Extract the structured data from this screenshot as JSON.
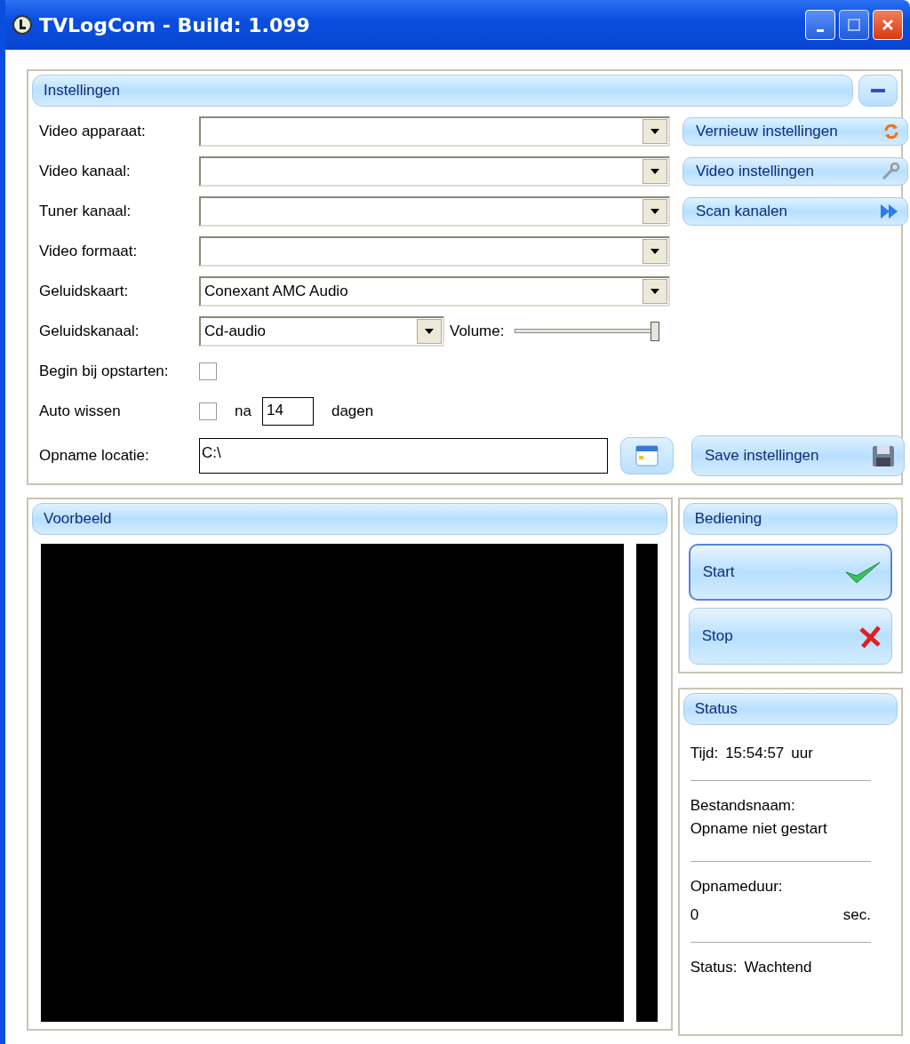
{
  "window": {
    "title": "TVLogCom - Build: 1.099"
  },
  "settings": {
    "title": "Instellingen",
    "rows": [
      {
        "kind": "combo",
        "label": "Video apparaat:"
      },
      {
        "kind": "combo",
        "label": "Video kanaal:"
      },
      {
        "kind": "combo",
        "label": "Tuner kanaal:"
      },
      {
        "kind": "combo",
        "label": "Video formaat:"
      },
      {
        "kind": "combo",
        "label": "Geluidskaart:",
        "value": "Conexant AMC Audio"
      },
      {
        "kind": "combo-volume",
        "label": "Geluidskanaal:",
        "value": "Cd-audio",
        "volume_label": "Volume:",
        "level": 0.98
      },
      {
        "kind": "checkbox",
        "label": "Begin bij opstarten:",
        "checked": false
      },
      {
        "kind": "auto-wipe",
        "label": "Auto wissen",
        "checked": false,
        "prefix": "na",
        "value": "14",
        "suffix": "dagen"
      },
      {
        "kind": "path",
        "label": "Opname locatie:",
        "value": "C:\\"
      }
    ],
    "actions": [
      {
        "kind": "refresh",
        "label": "Vernieuw instellingen"
      },
      {
        "kind": "wrench",
        "label": "Video instellingen"
      },
      {
        "kind": "forward",
        "label": "Scan kanalen"
      }
    ],
    "save": {
      "label": "Save instellingen"
    }
  },
  "preview": {
    "title": "Voorbeeld"
  },
  "controls": {
    "title": "Bediening",
    "buttons": [
      {
        "kind": "start",
        "label": "Start",
        "focused": true
      },
      {
        "kind": "stop",
        "label": "Stop",
        "focused": false
      }
    ]
  },
  "status": {
    "title": "Status",
    "time_label": "Tijd:",
    "time": "15:54:57",
    "time_unit": "uur",
    "file_label": "Bestandsnaam:",
    "file": "Opname niet gestart",
    "duration_label": "Opnameduur:",
    "duration": "0",
    "duration_unit": "sec.",
    "state_label": "Status:",
    "state": "Wachtend"
  }
}
